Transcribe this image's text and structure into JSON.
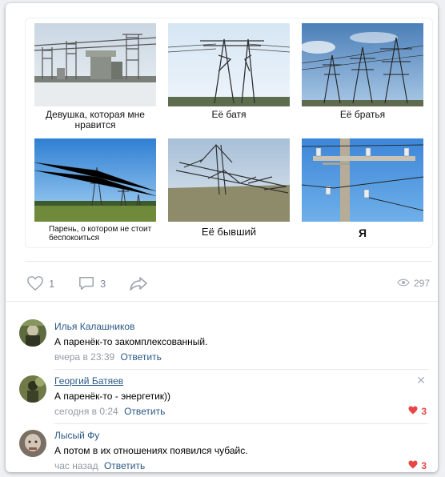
{
  "meme": {
    "captions": [
      "Девушка, которая мне нравится",
      "Её батя",
      "Её братья",
      "Парень, о котором не стоит беспокоиться",
      "Её бывший",
      "Я"
    ]
  },
  "actions": {
    "likes": "1",
    "comments": "3",
    "views": "297"
  },
  "comments": [
    {
      "author": "Илья Калашников",
      "text": "А паренёк-то закомплексованный.",
      "time": "вчера в 23:39",
      "reply": "Ответить",
      "likes": ""
    },
    {
      "author": "Георгий Батяев",
      "text": "А паренёк-то - энергетик))",
      "time": "сегодня в 0:24",
      "reply": "Ответить",
      "likes": "3"
    },
    {
      "author": "Лысый Фу",
      "text": "А потом в их отношениях появился чубайс.",
      "time": "час назад",
      "reply": "Ответить",
      "likes": "3"
    }
  ],
  "colors": {
    "link": "#2a5885",
    "muted": "#939ba6",
    "like": "#e64646",
    "sky": "#4a90d9"
  }
}
